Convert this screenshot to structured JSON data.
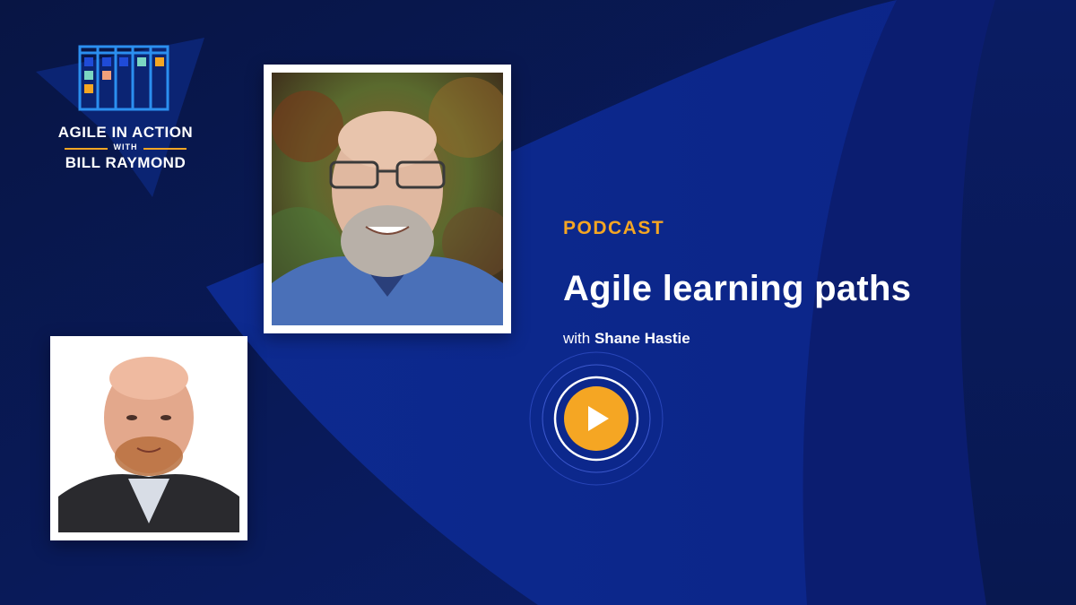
{
  "brand": {
    "line1": "AGILE IN ACTION",
    "with": "WITH",
    "line2": "BILL RAYMOND",
    "colors": {
      "accent": "#f5a623",
      "logo_blue": "#1e7fe0",
      "background": "#0a1a5c"
    }
  },
  "episode": {
    "type_label": "PODCAST",
    "title": "Agile learning paths",
    "guest_prefix": "with",
    "guest_name": "Shane Hastie"
  },
  "icons": {
    "play": "play-icon",
    "logo": "kanban-board-icon"
  }
}
